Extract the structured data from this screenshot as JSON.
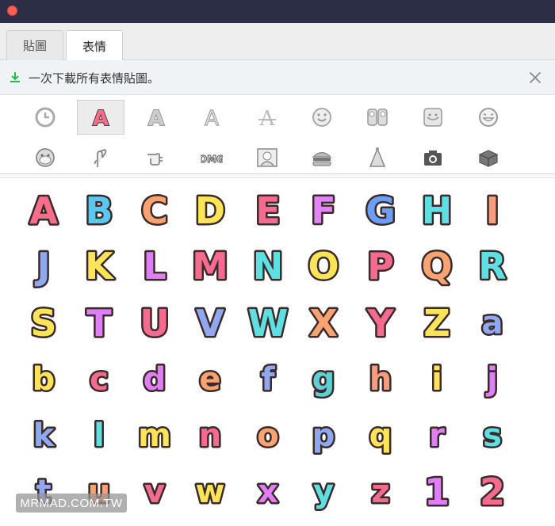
{
  "window": {
    "close_color": "#fe5f57"
  },
  "tabs": [
    {
      "label": "貼圖",
      "active": false
    },
    {
      "label": "表情",
      "active": true
    }
  ],
  "banner": {
    "text": "一次下載所有表情貼圖。",
    "icon": "download-icon",
    "close_icon": "close-icon"
  },
  "categories": [
    {
      "icon": "recent-clock-icon",
      "selected": false
    },
    {
      "icon": "pink-letter-a-icon",
      "selected": true
    },
    {
      "icon": "bold-letter-a-icon",
      "selected": false
    },
    {
      "icon": "outline-letter-a-icon",
      "selected": false
    },
    {
      "icon": "stylized-letter-a-icon",
      "selected": false
    },
    {
      "icon": "smiley-face-icon",
      "selected": false
    },
    {
      "icon": "couple-icon",
      "selected": false
    },
    {
      "icon": "girl-face-icon",
      "selected": false
    },
    {
      "icon": "grinning-face-icon",
      "selected": false
    },
    {
      "icon": "monkey-face-icon",
      "selected": false
    },
    {
      "icon": "crossed-fingers-icon",
      "selected": false
    },
    {
      "icon": "pointing-hand-icon",
      "selected": false
    },
    {
      "icon": "omg-text-icon",
      "selected": false
    },
    {
      "icon": "character-scene-icon",
      "selected": false
    },
    {
      "icon": "burger-icon",
      "selected": false
    },
    {
      "icon": "party-hat-icon",
      "selected": false
    },
    {
      "icon": "camera-icon",
      "selected": false
    },
    {
      "icon": "gift-box-icon",
      "selected": false
    }
  ],
  "stickers": [
    {
      "char": "A",
      "color": "#f76e8c"
    },
    {
      "char": "B",
      "color": "#5bc8ef"
    },
    {
      "char": "C",
      "color": "#f9a272"
    },
    {
      "char": "D",
      "color": "#fbe458"
    },
    {
      "char": "E",
      "color": "#f46b8f"
    },
    {
      "char": "F",
      "color": "#e085f3"
    },
    {
      "char": "G",
      "color": "#6c9ef4"
    },
    {
      "char": "H",
      "color": "#5ee0e2"
    },
    {
      "char": "I",
      "color": "#f49e7e"
    },
    {
      "char": "J",
      "color": "#8fa8f0"
    },
    {
      "char": "K",
      "color": "#fbe458"
    },
    {
      "char": "L",
      "color": "#e07ef5"
    },
    {
      "char": "M",
      "color": "#f46b8f"
    },
    {
      "char": "N",
      "color": "#5ee0e2"
    },
    {
      "char": "O",
      "color": "#fbe458"
    },
    {
      "char": "P",
      "color": "#f46b8f"
    },
    {
      "char": "Q",
      "color": "#f9a272"
    },
    {
      "char": "R",
      "color": "#5ee0e2"
    },
    {
      "char": "S",
      "color": "#fbe458"
    },
    {
      "char": "T",
      "color": "#e07ef5"
    },
    {
      "char": "U",
      "color": "#f46b8f"
    },
    {
      "char": "V",
      "color": "#8fa8f0"
    },
    {
      "char": "W",
      "color": "#5ee0e2"
    },
    {
      "char": "X",
      "color": "#f9a272"
    },
    {
      "char": "Y",
      "color": "#f46b8f"
    },
    {
      "char": "Z",
      "color": "#fbe458"
    },
    {
      "char": "a",
      "color": "#8fa8f0"
    },
    {
      "char": "b",
      "color": "#fbe458"
    },
    {
      "char": "c",
      "color": "#f46b8f"
    },
    {
      "char": "d",
      "color": "#e07ef5"
    },
    {
      "char": "e",
      "color": "#f9a272"
    },
    {
      "char": "f",
      "color": "#8fa8f0"
    },
    {
      "char": "g",
      "color": "#5ecfd4"
    },
    {
      "char": "h",
      "color": "#f49e7e"
    },
    {
      "char": "i",
      "color": "#fbe458"
    },
    {
      "char": "j",
      "color": "#e07ef5"
    },
    {
      "char": "k",
      "color": "#8fa8f0"
    },
    {
      "char": "l",
      "color": "#5ee0e2"
    },
    {
      "char": "m",
      "color": "#fbe458"
    },
    {
      "char": "n",
      "color": "#f46b8f"
    },
    {
      "char": "o",
      "color": "#f9a272"
    },
    {
      "char": "p",
      "color": "#8fa8f0"
    },
    {
      "char": "q",
      "color": "#fbe458"
    },
    {
      "char": "r",
      "color": "#e07ef5"
    },
    {
      "char": "s",
      "color": "#5ee0e2"
    },
    {
      "char": "t",
      "color": "#8fa8f0"
    },
    {
      "char": "u",
      "color": "#f9a272"
    },
    {
      "char": "v",
      "color": "#f46b8f"
    },
    {
      "char": "w",
      "color": "#fbe458"
    },
    {
      "char": "x",
      "color": "#e07ef5"
    },
    {
      "char": "y",
      "color": "#5ee0e2"
    },
    {
      "char": "z",
      "color": "#f46b8f"
    },
    {
      "char": "1",
      "color": "#e07ef5"
    },
    {
      "char": "2",
      "color": "#f46b8f"
    }
  ],
  "watermark": {
    "text": "MRMAD.COM.TW"
  }
}
